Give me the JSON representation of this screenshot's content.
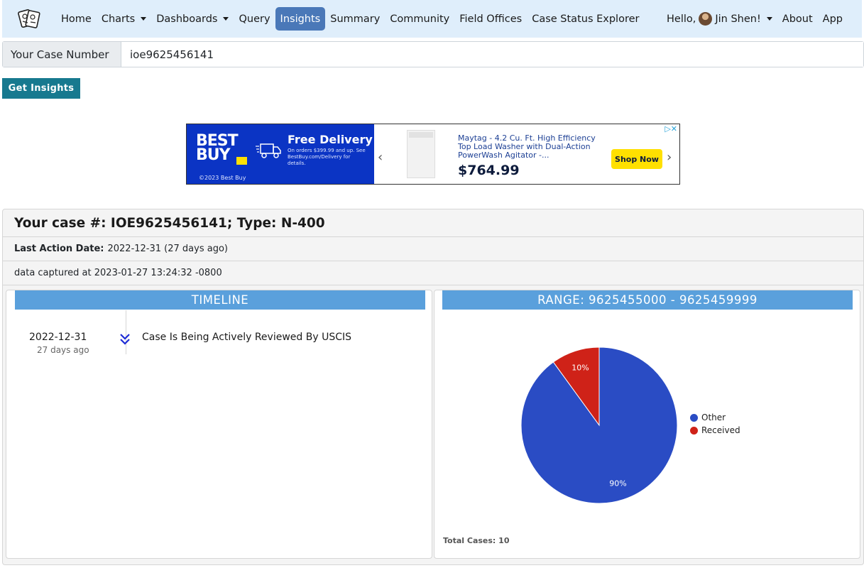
{
  "nav": {
    "items": [
      {
        "label": "Home",
        "dropdown": false,
        "active": false
      },
      {
        "label": "Charts",
        "dropdown": true,
        "active": false
      },
      {
        "label": "Dashboards",
        "dropdown": true,
        "active": false
      },
      {
        "label": "Query",
        "dropdown": false,
        "active": false
      },
      {
        "label": "Insights",
        "dropdown": false,
        "active": true
      },
      {
        "label": "Summary",
        "dropdown": false,
        "active": false
      },
      {
        "label": "Community",
        "dropdown": false,
        "active": false
      },
      {
        "label": "Field Offices",
        "dropdown": false,
        "active": false
      },
      {
        "label": "Case Status Explorer",
        "dropdown": false,
        "active": false
      }
    ],
    "greeting": "Hello,",
    "user_name": "Jin Shen!",
    "about": "About",
    "app": "App",
    "active_color": "#4a78b8"
  },
  "case_input": {
    "label": "Your Case Number",
    "value": "ioe9625456141"
  },
  "get_insights_button": "Get Insights",
  "ad": {
    "brand_line1": "BEST",
    "brand_line2": "BUY",
    "headline": "Free Delivery",
    "subtext": "On orders $399.99 and up. See BestBuy.com/Delivery for details.",
    "copyright": "©2023 Best Buy",
    "product": "Maytag - 4.2 Cu. Ft. High Efficiency Top Load Washer with Dual-Action PowerWash Agitator -...",
    "price": "$764.99",
    "cta": "Shop Now"
  },
  "case": {
    "title": "Your case #: IOE9625456141; Type: N-400",
    "last_action_label": "Last Action Date:",
    "last_action_value": "2022-12-31 (27 days ago)",
    "captured": "data captured at 2023-01-27 13:24:32 -0800"
  },
  "timeline": {
    "heading": "TIMELINE",
    "entries": [
      {
        "date": "2022-12-31",
        "ago": "27 days ago",
        "event": "Case Is Being Actively Reviewed By USCIS"
      }
    ]
  },
  "range": {
    "heading": "RANGE: 9625455000 - 9625459999",
    "total_label": "Total Cases: 10"
  },
  "chart_data": {
    "type": "pie",
    "categories": [
      "Other",
      "Received"
    ],
    "values": [
      90,
      10
    ],
    "labels": [
      "90%",
      "10%"
    ],
    "colors": [
      "#2a4cc4",
      "#cf2218"
    ],
    "legend": "right"
  }
}
